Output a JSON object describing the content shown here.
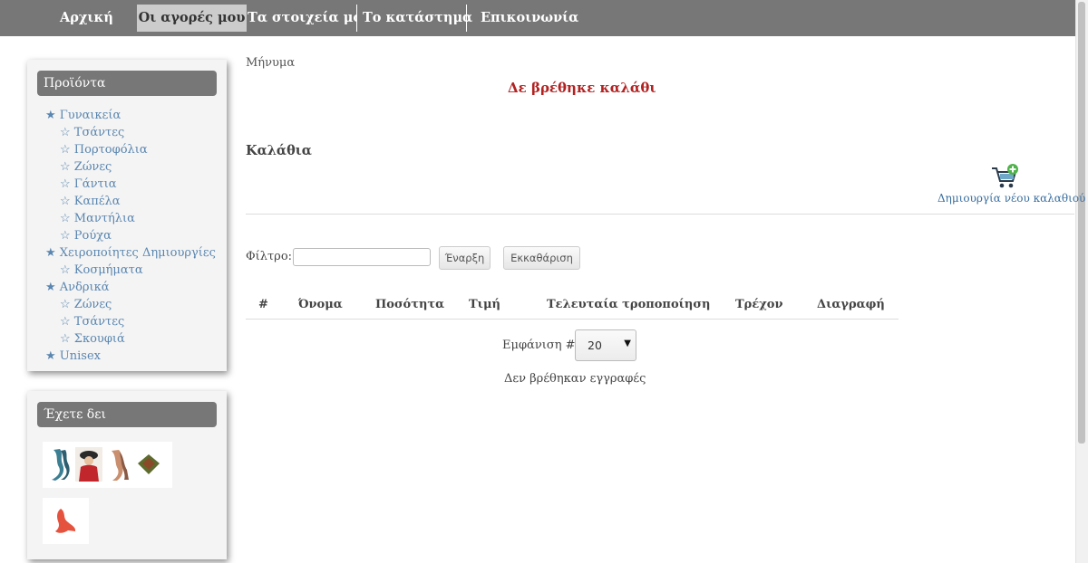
{
  "nav": {
    "home": "Αρχική",
    "purchases": "Οι αγορές μου",
    "details": "Τα στοιχεία μου",
    "store": "Το κατάστημα",
    "contact": "Επικοινωνία"
  },
  "sidebar": {
    "products_title": "Προϊόντα",
    "categories": [
      {
        "label": "★ Γυναικεία"
      },
      {
        "label": "☆ Τσάντες"
      },
      {
        "label": "☆ Πορτοφόλια"
      },
      {
        "label": "☆ Ζώνες"
      },
      {
        "label": "☆ Γάντια"
      },
      {
        "label": "☆ Καπέλα"
      },
      {
        "label": "☆ Μαντήλια"
      },
      {
        "label": "☆ Ρούχα"
      },
      {
        "label": "★ Χειροποίητες Δημιουργίες"
      },
      {
        "label": "☆ Κοσμήματα"
      },
      {
        "label": "★ Ανδρικά"
      },
      {
        "label": "☆ Ζώνες"
      },
      {
        "label": "☆ Τσάντες"
      },
      {
        "label": "☆ Σκουφιά"
      },
      {
        "label": "★ Unisex"
      }
    ],
    "viewed_title": "Έχετε δει"
  },
  "main": {
    "message_label": "Μήνυμα",
    "no_cart_message": "Δε βρέθηκε καλάθι",
    "carts_heading": "Καλάθια",
    "new_cart_label": "Δημιουργία νέου καλαθιού",
    "filter": {
      "label": "Φίλτρο:",
      "value": "",
      "start_label": "Έναρξη",
      "clear_label": "Εκκαθάριση"
    },
    "table": {
      "headers": [
        "#",
        "Όνομα",
        "Ποσότητα",
        "Τιμή",
        "Τελευταία τροποποίηση",
        "Τρέχον",
        "Διαγραφή"
      ]
    },
    "page_size": {
      "label": "Εμφάνιση #",
      "value": "20"
    },
    "no_records": "Δεν βρέθηκαν εγγραφές"
  }
}
